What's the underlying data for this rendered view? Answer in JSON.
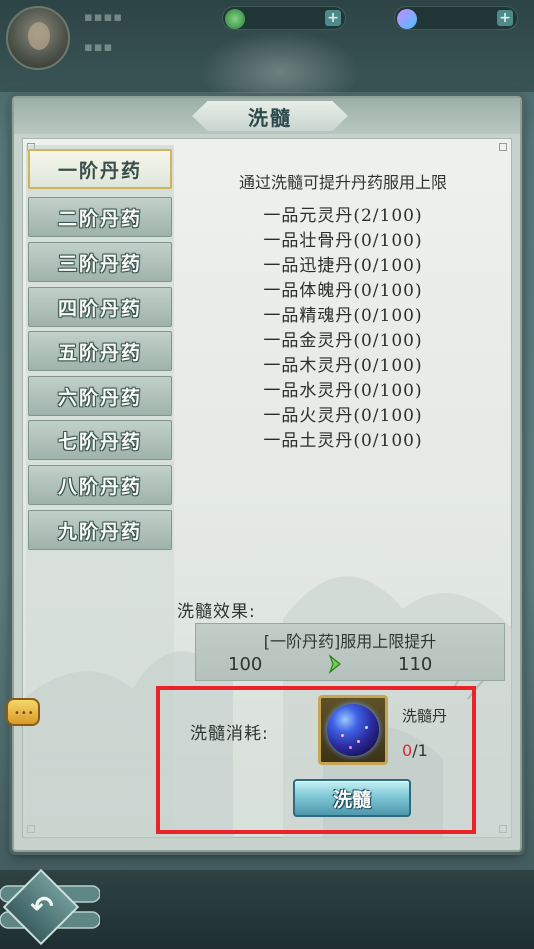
{
  "title": "洗髓",
  "tabs": [
    {
      "label": "一阶丹药",
      "active": true
    },
    {
      "label": "二阶丹药",
      "active": false
    },
    {
      "label": "三阶丹药",
      "active": false
    },
    {
      "label": "四阶丹药",
      "active": false
    },
    {
      "label": "五阶丹药",
      "active": false
    },
    {
      "label": "六阶丹药",
      "active": false
    },
    {
      "label": "七阶丹药",
      "active": false
    },
    {
      "label": "八阶丹药",
      "active": false
    },
    {
      "label": "九阶丹药",
      "active": false
    }
  ],
  "description": "通过洗髓可提升丹药服用上限",
  "pills": [
    "一品元灵丹(2/100)",
    "一品壮骨丹(0/100)",
    "一品迅捷丹(0/100)",
    "一品体魄丹(0/100)",
    "一品精魂丹(0/100)",
    "一品金灵丹(0/100)",
    "一品木灵丹(0/100)",
    "一品水灵丹(0/100)",
    "一品火灵丹(0/100)",
    "一品土灵丹(0/100)"
  ],
  "effect": {
    "label": "洗髓效果:",
    "title": "[一阶丹药]服用上限提升",
    "from": "100",
    "to": "110"
  },
  "cost": {
    "label": "洗髓消耗:",
    "item_name": "洗髓丹",
    "have": "0",
    "need": "/1"
  },
  "action_button": "洗髓",
  "colors": {
    "highlight_box": "#e8242a",
    "count_insufficient": "#d92b2b",
    "active_tab_border": "#d2b35a"
  },
  "icons": {
    "item": "blue-orb-icon",
    "effect_arrow": "green-chevron-right-icon",
    "back": "back-arrow-icon",
    "chat": "chat-bubble-icon"
  }
}
